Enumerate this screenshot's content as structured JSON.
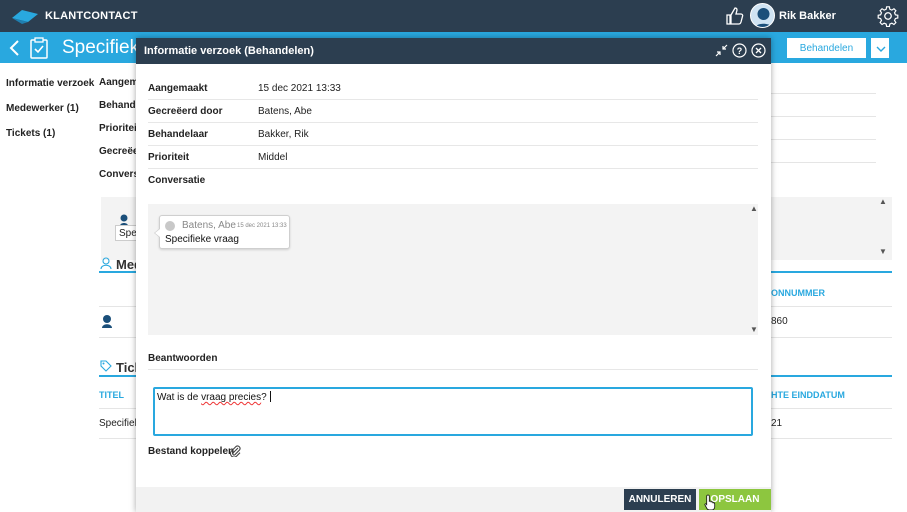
{
  "topbar": {
    "brand": "KLANTCONTACT",
    "user_name": "Rik Bakker"
  },
  "header": {
    "page_title": "Specifiek",
    "action_button": "Behandelen"
  },
  "sidebar": {
    "items": [
      {
        "label": "Informatie verzoek"
      },
      {
        "label": "Medewerker (1)"
      },
      {
        "label": "Tickets (1)"
      }
    ]
  },
  "background": {
    "fields": [
      "Aangem",
      "Behande",
      "Prioriteit",
      "Gecreëe",
      "Convers"
    ],
    "bubble_text": "Spe",
    "sections": {
      "medewerker": "Med",
      "tickets": "Tick"
    },
    "medewerker_table": {
      "col": "ONNUMMER",
      "value": "860"
    },
    "tickets_table": {
      "col_title": "TITEL",
      "col_date": "HTE EINDDATUM",
      "row_title": "Specifiek",
      "row_date": "21"
    }
  },
  "modal": {
    "title": "Informatie verzoek (Behandelen)",
    "fields": [
      {
        "label": "Aangemaakt",
        "value": "15 dec 2021 13:33"
      },
      {
        "label": "Gecreëerd door",
        "value": "Batens, Abe"
      },
      {
        "label": "Behandelaar",
        "value": "Bakker, Rik"
      },
      {
        "label": "Prioriteit",
        "value": "Middel"
      }
    ],
    "conversation_label": "Conversatie",
    "message": {
      "author": "Batens, Abe",
      "time": "15 dec 2021 13:33",
      "text": "Specifieke vraag"
    },
    "answer_label": "Beantwoorden",
    "answer": {
      "part1": "Wat is de ",
      "part2": "vraag precies",
      "part3": "?"
    },
    "attach_label": "Bestand koppelen",
    "cancel_button": "ANNULEREN",
    "save_button": "OPSLAAN"
  },
  "colors": {
    "dark": "#2c3e50",
    "accent": "#29a8df",
    "save": "#8dc63f"
  }
}
